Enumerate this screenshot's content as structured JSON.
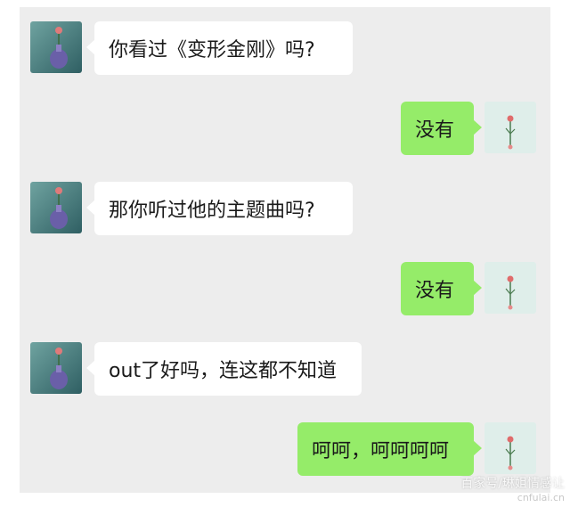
{
  "messages": [
    {
      "side": "in",
      "text": "你看过《变形金刚》吗?",
      "avatar": "vase-flower-avatar"
    },
    {
      "side": "out",
      "text": "没有",
      "avatar": "flower-sketch-avatar"
    },
    {
      "side": "in",
      "text": "那你听过他的主题曲吗?",
      "avatar": "vase-flower-avatar"
    },
    {
      "side": "out",
      "text": "没有",
      "avatar": "flower-sketch-avatar"
    },
    {
      "side": "in",
      "text": "out了好吗，连这都不知道",
      "avatar": "vase-flower-avatar"
    },
    {
      "side": "out",
      "text": "呵呵，呵呵呵呵",
      "avatar": "flower-sketch-avatar"
    }
  ],
  "watermark": {
    "text": "百家号/琳姐情感让",
    "site": "cnfulai.cn"
  },
  "colors": {
    "background": "#ededed",
    "incoming_bubble": "#ffffff",
    "outgoing_bubble": "#95ec69"
  }
}
